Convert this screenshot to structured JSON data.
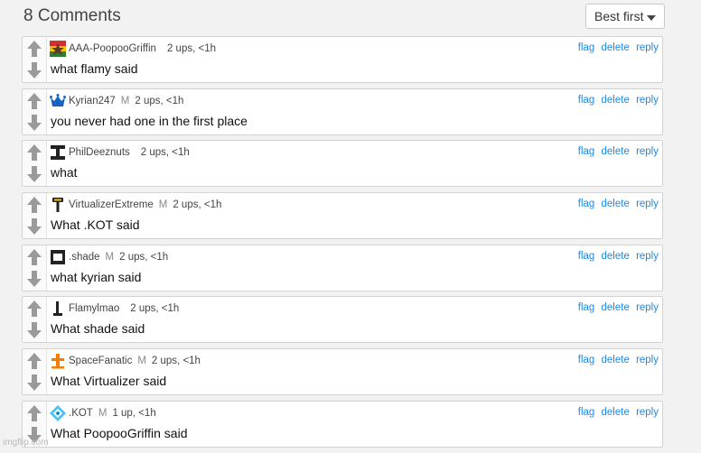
{
  "header": {
    "count_label": "8 Comments",
    "sort_label": "Best first"
  },
  "actions": {
    "flag": "flag",
    "delete": "delete",
    "reply": "reply"
  },
  "comments": [
    {
      "user": "AAA-PoopooGriffin",
      "mod": "",
      "score": "2 ups, <1h",
      "text": "what flamy said",
      "avatar_icon": "flag-avatar-icon"
    },
    {
      "user": "Kyrian247",
      "mod": "M",
      "score": "2 ups, <1h",
      "text": "you never had one in the first place",
      "avatar_icon": "crown-avatar-icon"
    },
    {
      "user": "PhilDeeznuts",
      "mod": "",
      "score": "2 ups, <1h",
      "text": "what",
      "avatar_icon": "i-beam-avatar-icon"
    },
    {
      "user": "VirtualizerExtreme",
      "mod": "M",
      "score": "2 ups, <1h",
      "text": "What .KOT said",
      "avatar_icon": "hammer-avatar-icon"
    },
    {
      "user": ".shade",
      "mod": "M",
      "score": "2 ups, <1h",
      "text": "what kyrian said",
      "avatar_icon": "frame-avatar-icon"
    },
    {
      "user": "Flamylmao",
      "mod": "",
      "score": "2 ups, <1h",
      "text": "What shade said",
      "avatar_icon": "pillar-avatar-icon"
    },
    {
      "user": "SpaceFanatic",
      "mod": "M",
      "score": "2 ups, <1h",
      "text": "What Virtualizer said",
      "avatar_icon": "orange-cross-avatar-icon"
    },
    {
      "user": ".KOT",
      "mod": "M",
      "score": "1 up, <1h",
      "text": "What PoopooGriffin said",
      "avatar_icon": "diamond-avatar-icon"
    }
  ],
  "watermark": "imgflip.com",
  "colors": {
    "link": "#1e88e5",
    "arrow": "#9a9a9a",
    "background": "#f2f2f2"
  }
}
